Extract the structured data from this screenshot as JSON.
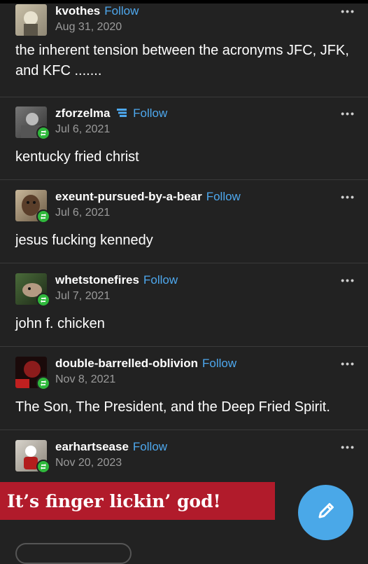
{
  "posts": [
    {
      "username": "kvothes",
      "follow": "Follow",
      "date": "Aug 31, 2020",
      "text": "the inherent tension between the acronyms JFC, JFK, and KFC ......."
    },
    {
      "username": "zforzelma",
      "follow": "Follow",
      "date": "Jul 6, 2021",
      "text": "kentucky fried christ"
    },
    {
      "username": "exeunt-pursued-by-a-bear",
      "follow": "Follow",
      "date": "Jul 6, 2021",
      "text": "jesus fucking kennedy"
    },
    {
      "username": "whetstonefires",
      "follow": "Follow",
      "date": "Jul 7, 2021",
      "text": "john f. chicken"
    },
    {
      "username": "double-barrelled-oblivion",
      "follow": "Follow",
      "date": "Nov 8, 2021",
      "text": "The Son, The President, and the Deep Fried Spirit."
    },
    {
      "username": "earhartsease",
      "follow": "Follow",
      "date": "Nov 20, 2023",
      "text": ""
    }
  ],
  "more_label": "•••",
  "banner_text": "It’s finger lickin’ god!",
  "colors": {
    "background": "#222222",
    "follow": "#4ea8ee",
    "reblog": "#2fb83c",
    "banner": "#b11b2b",
    "fab": "#4aa8e8"
  }
}
